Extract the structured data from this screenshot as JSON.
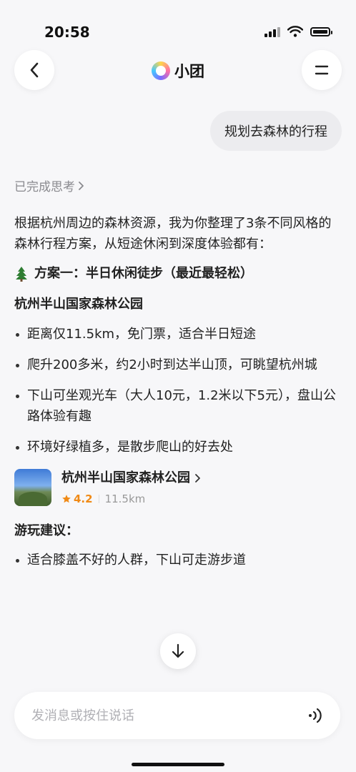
{
  "status_bar": {
    "time": "20:58"
  },
  "nav": {
    "title": "小团"
  },
  "user_message": "规划去森林的行程",
  "thinking_label": "已完成思考",
  "reply": {
    "intro": "根据杭州周边的森林资源，我为你整理了3条不同风格的森林行程方案，从短途休闲到深度体验都有：",
    "plan1_title": "方案一：半日休闲徒步（最近最轻松）",
    "place_name": "杭州半山国家森林公园",
    "bullets": [
      "距离仅11.5km，免门票，适合半日短途",
      "爬升200多米，约2小时到达半山顶，可眺望杭州城",
      "下山可坐观光车（大人10元，1.2米以下5元），盘山公路体验有趣",
      "环境好绿植多，是散步爬山的好去处"
    ],
    "poi": {
      "name": "杭州半山国家森林公园",
      "rating": "4.2",
      "distance": "11.5km"
    },
    "tips_title": "游玩建议：",
    "tips": [
      "适合膝盖不好的人群，下山可走游步道"
    ]
  },
  "input": {
    "placeholder": "发消息或按住说话"
  }
}
